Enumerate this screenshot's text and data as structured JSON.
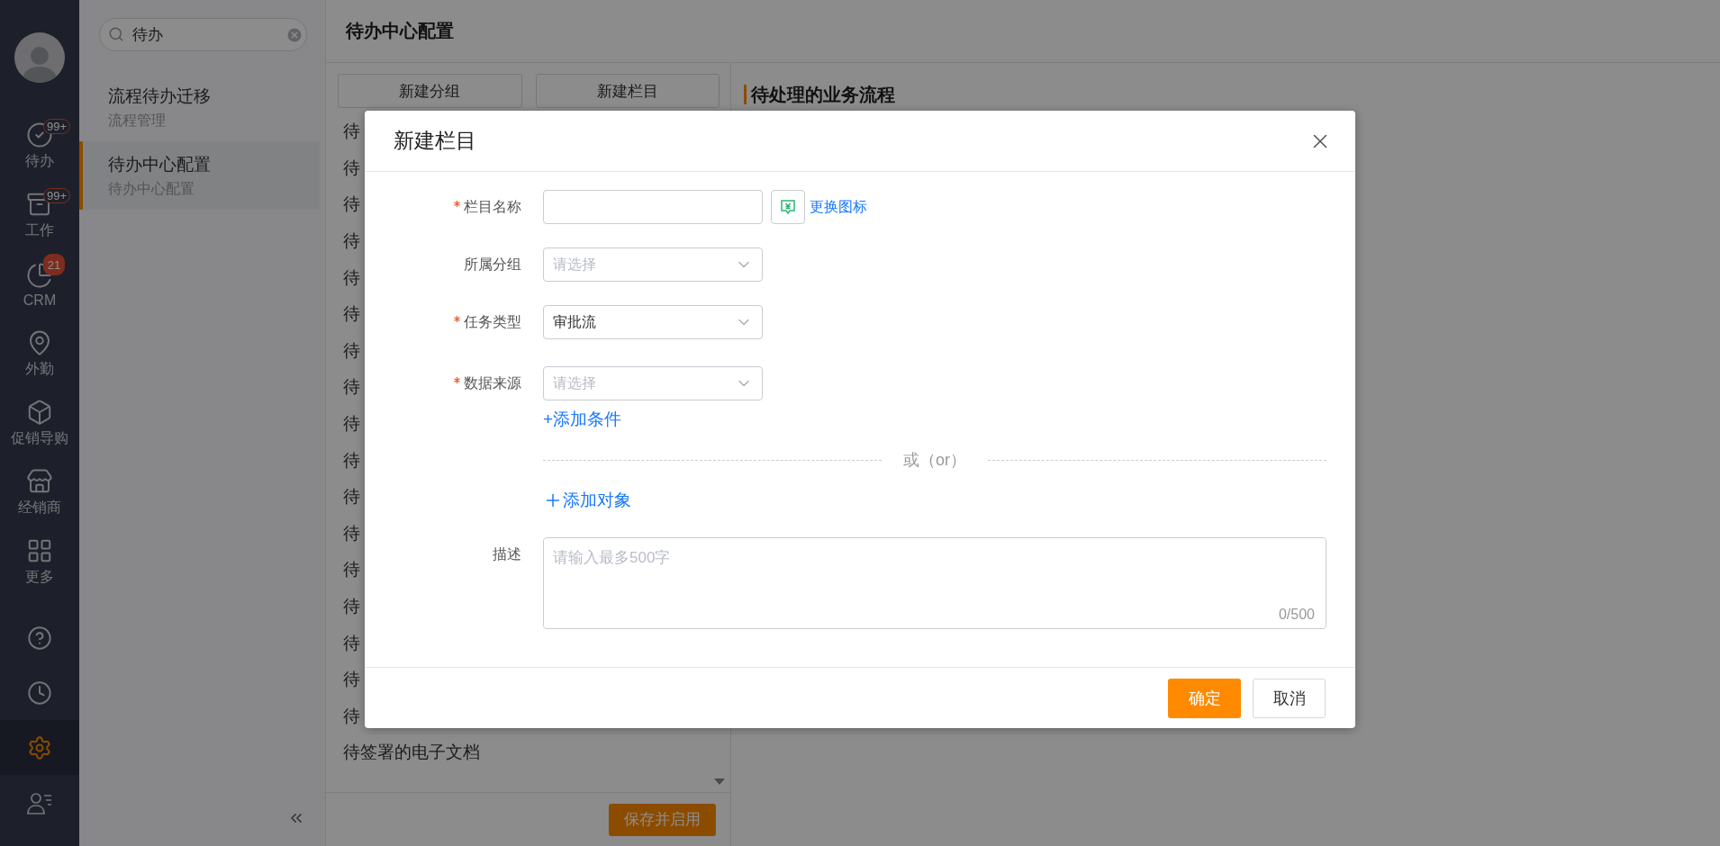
{
  "nav": {
    "items": [
      {
        "label": "待办",
        "badge": "99+",
        "kind": "outline",
        "selected": false
      },
      {
        "label": "工作",
        "badge": "99+",
        "kind": "outline",
        "selected": false
      },
      {
        "label": "CRM",
        "badge": "21",
        "kind": "filled",
        "selected": false
      },
      {
        "label": "外勤",
        "selected": false
      },
      {
        "label": "促销导购",
        "selected": false
      },
      {
        "label": "经销商",
        "selected": false
      },
      {
        "label": "更多",
        "selected": false
      }
    ],
    "tools": [
      {
        "selected": false
      },
      {
        "selected": false
      },
      {
        "selected": true
      },
      {
        "selected": false
      }
    ]
  },
  "search": {
    "value": "待办"
  },
  "results": [
    {
      "title": "流程待办迁移",
      "subtitle": "流程管理",
      "selected": false
    },
    {
      "title": "待办中心配置",
      "subtitle": "待办中心配置",
      "selected": true
    }
  ],
  "page_title": "待办中心配置",
  "toolbar_buttons": [
    "新建分组",
    "新建栏目"
  ],
  "columns": [
    {
      "label": "待"
    },
    {
      "label": "待"
    },
    {
      "label": "待"
    },
    {
      "label": "待"
    },
    {
      "label": "待"
    },
    {
      "label": "待"
    },
    {
      "label": "待"
    },
    {
      "label": "待"
    },
    {
      "label": "待"
    },
    {
      "label": "待"
    },
    {
      "label": "待"
    },
    {
      "label": "待"
    },
    {
      "label": "待"
    },
    {
      "label": "待"
    },
    {
      "label": "待"
    },
    {
      "label": "待"
    },
    {
      "label": "待"
    },
    {
      "label": "待签署的电子文档"
    }
  ],
  "save_button": "保存并启用",
  "section_title": "待处理的业务流程",
  "dialog": {
    "title": "新建栏目",
    "fields": [
      {
        "kind": "text",
        "label": "栏目名称",
        "required": true,
        "action": "更换图标"
      },
      {
        "kind": "select",
        "label": "所属分组",
        "required": false,
        "placeholder": "请选择"
      },
      {
        "kind": "select",
        "label": "任务类型",
        "required": true,
        "value": "审批流"
      },
      {
        "kind": "select",
        "label": "数据来源",
        "required": true,
        "placeholder": "请选择"
      }
    ],
    "add_condition": "+添加条件",
    "separator": "或（or）",
    "add_object": "添加对象",
    "description": {
      "label": "描述",
      "placeholder": "请输入最多500字",
      "counter": "0/500"
    },
    "buttons": [
      {
        "label": "确定",
        "kind": "primary"
      },
      {
        "label": "取消",
        "kind": "default"
      }
    ]
  }
}
